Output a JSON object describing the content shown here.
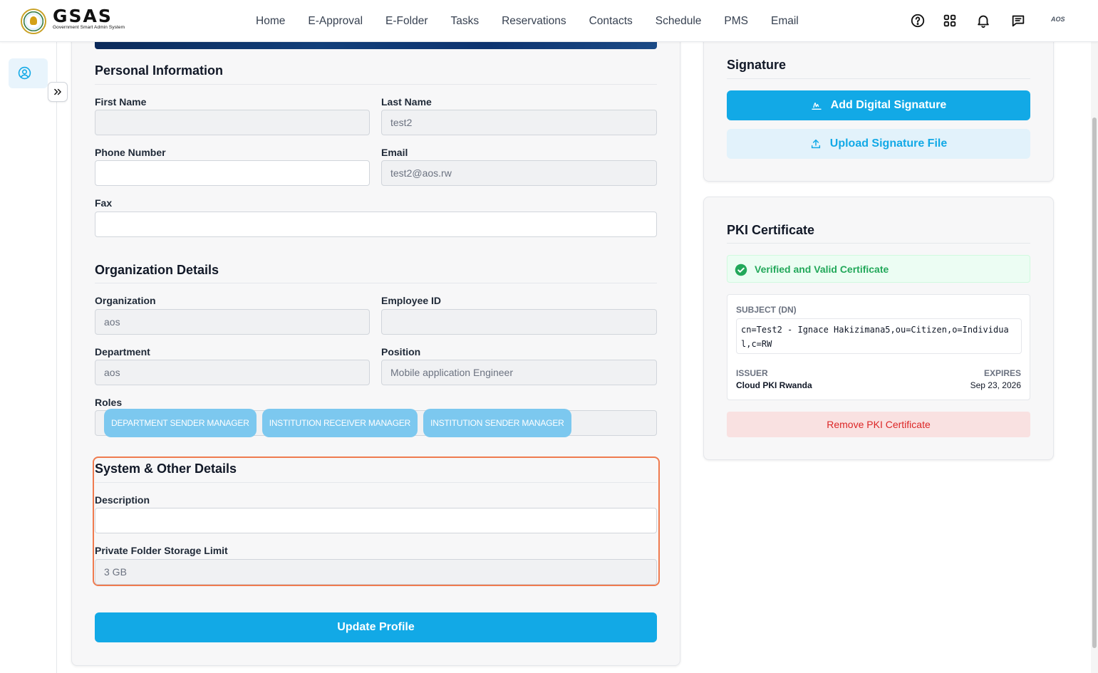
{
  "app": {
    "logo_text": "GSAS",
    "logo_subtitle": "Government Smart Admin System",
    "avatar_text": "AOS"
  },
  "nav": [
    "Home",
    "E-Approval",
    "E-Folder",
    "Tasks",
    "Reservations",
    "Contacts",
    "Schedule",
    "PMS",
    "Email"
  ],
  "top_icons": [
    "help-icon",
    "apps-grid-icon",
    "bell-icon",
    "chat-icon"
  ],
  "personal": {
    "title": "Personal Information",
    "first_name": {
      "label": "First Name",
      "value": ""
    },
    "last_name": {
      "label": "Last Name",
      "value": "test2"
    },
    "phone": {
      "label": "Phone Number",
      "value": ""
    },
    "email": {
      "label": "Email",
      "value": "test2@aos.rw"
    },
    "fax": {
      "label": "Fax",
      "value": ""
    }
  },
  "organization": {
    "title": "Organization Details",
    "organization": {
      "label": "Organization",
      "value": "aos"
    },
    "employee_id": {
      "label": "Employee ID",
      "value": ""
    },
    "department": {
      "label": "Department",
      "value": "aos"
    },
    "position": {
      "label": "Position",
      "value": "Mobile application Engineer"
    },
    "roles_label": "Roles",
    "roles": [
      "DEPARTMENT SENDER MANAGER",
      "INSTITUTION RECEIVER MANAGER",
      "INSTITUTION SENDER MANAGER"
    ]
  },
  "system": {
    "title": "System & Other Details",
    "description": {
      "label": "Description",
      "value": ""
    },
    "storage": {
      "label": "Private Folder Storage Limit",
      "value": "3 GB"
    }
  },
  "update_button": "Update Profile",
  "signature": {
    "title": "Signature",
    "add_button": "Add Digital Signature",
    "upload_button": "Upload Signature File"
  },
  "pki": {
    "title": "PKI Certificate",
    "status": "Verified and Valid Certificate",
    "subject_label": "SUBJECT (DN)",
    "subject_value": "cn=Test2 - Ignace Hakizimana5,ou=Citizen,o=Individual,c=RW",
    "issuer_label": "ISSUER",
    "issuer_value": "Cloud PKI Rwanda",
    "expires_label": "EXPIRES",
    "expires_value": "Sep 23, 2026",
    "remove_button": "Remove PKI Certificate"
  },
  "colors": {
    "primary": "#12a9e6",
    "highlight": "#ef7b4f",
    "success": "#22a85a",
    "danger": "#dc2626"
  }
}
